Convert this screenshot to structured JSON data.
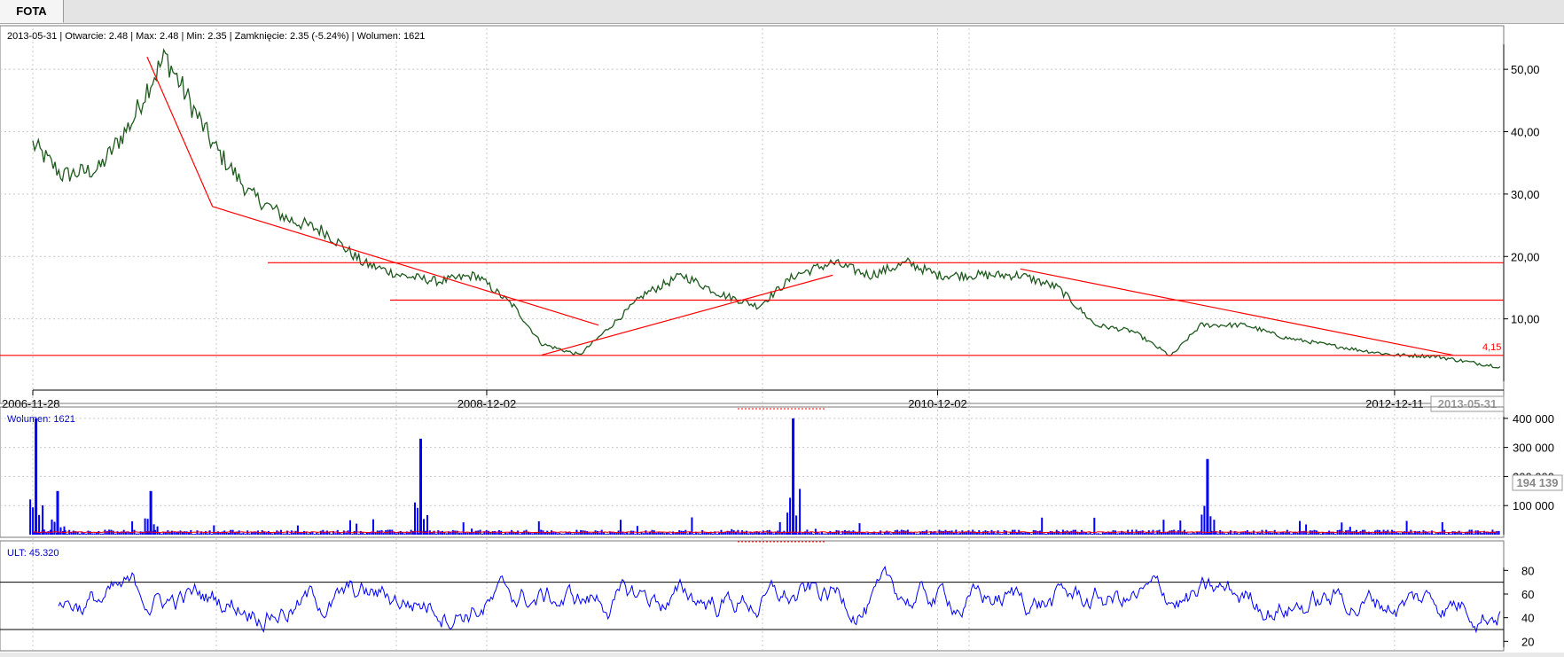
{
  "tab": {
    "label": "FOTA"
  },
  "info_bar": "2013-05-31 | Otwarcie: 2.48 | Max: 2.48 | Min: 2.35 | Zamknięcie: 2.35 (-5.24%)  | Wolumen: 1621",
  "price_panel": {
    "y_ticks": [
      "50,00",
      "40,00",
      "30,00",
      "20,00",
      "10,00"
    ],
    "x_labels": [
      "2006-11-28",
      "2008-12-02",
      "2010-12-02",
      "2012-12-11"
    ],
    "cursor_date": "2013-05-31",
    "level_label": "4,15"
  },
  "volume_panel": {
    "label": "Wolumen: 1621",
    "y_ticks": [
      "400 000",
      "300 000",
      "200 000",
      "100 000"
    ],
    "cursor_value": "194 139"
  },
  "ult_panel": {
    "label": "ULT: 45.320",
    "y_ticks": [
      "80",
      "60",
      "40",
      "20"
    ]
  },
  "colors": {
    "price_line": "#1e5a1e",
    "trendline": "#ff0000",
    "volume_bars": "#0000ff",
    "volume_ma": "#ff0000",
    "ult_line": "#0000ff",
    "grid": "#c8c8c8"
  },
  "chart_data": [
    {
      "type": "line",
      "title": "FOTA",
      "x": [
        "2006-11-28",
        "2007-01-15",
        "2007-03-15",
        "2007-05-10",
        "2007-06-01",
        "2007-07-01",
        "2007-09-15",
        "2007-11-15",
        "2008-01-15",
        "2008-03-15",
        "2008-05-15",
        "2008-07-15",
        "2008-09-15",
        "2008-11-15",
        "2009-01-15",
        "2009-03-01",
        "2009-05-01",
        "2009-06-01",
        "2009-08-15",
        "2009-10-15",
        "2009-12-15",
        "2010-02-15",
        "2010-04-15",
        "2010-06-15",
        "2010-08-15",
        "2010-10-15",
        "2010-12-02",
        "2011-02-15",
        "2011-04-15",
        "2011-06-15",
        "2011-08-15",
        "2011-10-15",
        "2011-12-15",
        "2012-02-01",
        "2012-04-15",
        "2012-06-15",
        "2012-08-15",
        "2012-10-15",
        "2012-12-11",
        "2013-02-15",
        "2013-04-15",
        "2013-05-31"
      ],
      "y": [
        38,
        33,
        34,
        42,
        47,
        52,
        38,
        30,
        26,
        24,
        19,
        17,
        16,
        17,
        12,
        6,
        4.2,
        7,
        14,
        17,
        14,
        12,
        17,
        19,
        17,
        19,
        17,
        17,
        17,
        15,
        9,
        8,
        4,
        9,
        9,
        7,
        6,
        5,
        4.2,
        4,
        3,
        2.35
      ],
      "ylim": [
        0,
        54
      ],
      "y_tick_values": [
        10,
        20,
        30,
        40,
        50
      ],
      "horizontal_levels": [
        19,
        13,
        4.15
      ],
      "level_label": "4,15",
      "trendlines": [
        {
          "from": [
            "2007-06-01",
            52
          ],
          "to": [
            "2007-09-15",
            28
          ]
        },
        {
          "from": [
            "2007-09-15",
            28
          ],
          "to": [
            "2009-06-01",
            9
          ]
        },
        {
          "from": [
            "2009-03-01",
            4.2
          ],
          "to": [
            "2010-06-15",
            17
          ]
        },
        {
          "from": [
            "2011-04-15",
            18
          ],
          "to": [
            "2013-03-15",
            4.2
          ]
        }
      ]
    },
    {
      "type": "bar",
      "title": "Wolumen",
      "ylim": [
        0,
        430000
      ],
      "y_tick_values": [
        100000,
        200000,
        300000,
        400000
      ],
      "spikes": [
        {
          "x": "2006-12-01",
          "value": 400000
        },
        {
          "x": "2007-01-05",
          "value": 150000
        },
        {
          "x": "2007-06-05",
          "value": 150000
        },
        {
          "x": "2008-08-15",
          "value": 330000
        },
        {
          "x": "2010-04-10",
          "value": 400000
        },
        {
          "x": "2012-02-10",
          "value": 260000
        }
      ]
    },
    {
      "type": "line",
      "title": "ULT",
      "ylim": [
        15,
        90
      ],
      "y_tick_values": [
        20,
        40,
        60,
        80
      ],
      "reference_levels": [
        70,
        30
      ],
      "last_value": 45.32
    }
  ]
}
